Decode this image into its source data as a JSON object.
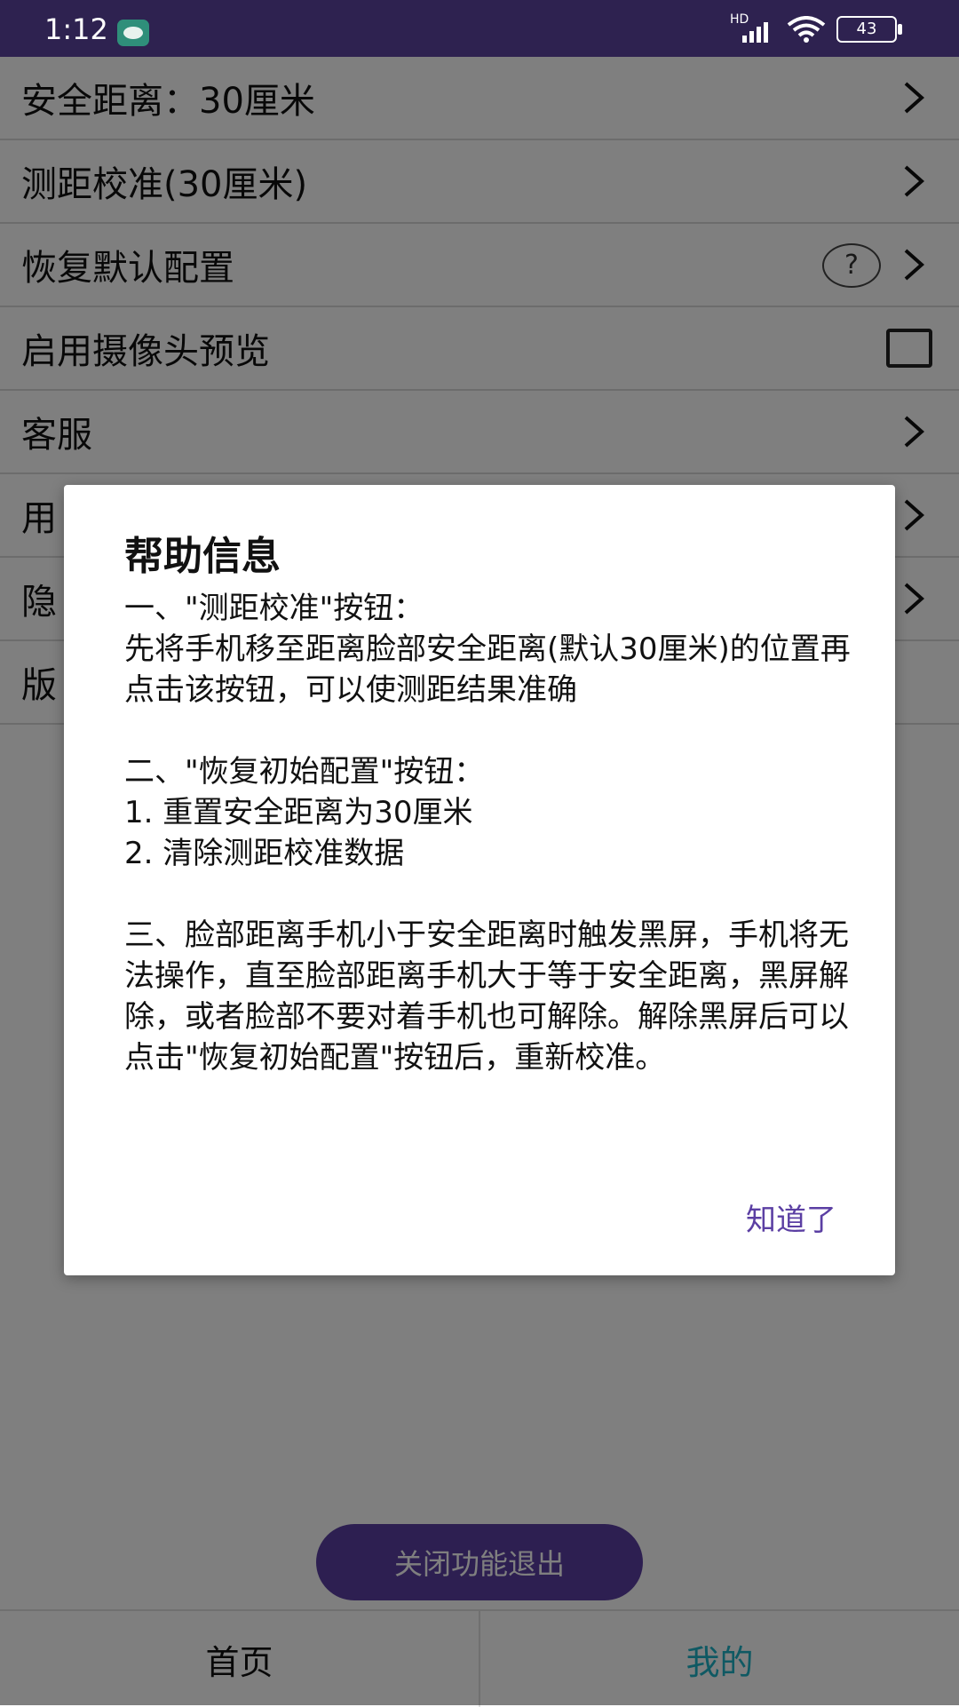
{
  "statusbar": {
    "time": "1:12",
    "network": "HD",
    "battery": "43"
  },
  "settings": {
    "items": [
      {
        "label": "安全距离：30厘米",
        "trailing": "chevron"
      },
      {
        "label": "测距校准(30厘米)",
        "trailing": "chevron"
      },
      {
        "label": "恢复默认配置",
        "trailing": "help-chevron",
        "help_glyph": "?"
      },
      {
        "label": "启用摄像头预览",
        "trailing": "checkbox"
      },
      {
        "label": "客服",
        "trailing": "chevron"
      },
      {
        "label": "用",
        "trailing": "chevron"
      },
      {
        "label": "隐",
        "trailing": "chevron"
      },
      {
        "label": "版",
        "trailing": "none"
      }
    ]
  },
  "exit_button": {
    "label": "关闭功能退出"
  },
  "bottom_nav": {
    "tabs": [
      {
        "label": "首页"
      },
      {
        "label": "我的"
      }
    ]
  },
  "dialog": {
    "title": "帮助信息",
    "paragraphs": [
      "一、\"测距校准\"按钮：",
      "先将手机移至距离脸部安全距离(默认30厘米)的位置再点击该按钮，可以使测距结果准确",
      "",
      "二、\"恢复初始配置\"按钮：",
      "1. 重置安全距离为30厘米",
      "2. 清除测距校准数据",
      "",
      "三、脸部距离手机小于安全距离时触发黑屏，手机将无法操作，直至脸部距离手机大于等于安全距离，黑屏解除，或者脸部不要对着手机也可解除。解除黑屏后可以点击\"恢复初始配置\"按钮后，重新校准。"
    ],
    "ok_label": "知道了"
  },
  "colors": {
    "statusbar": "#2e2250",
    "accent": "#5b3fa3",
    "tab_active": "#1fb3c7"
  }
}
